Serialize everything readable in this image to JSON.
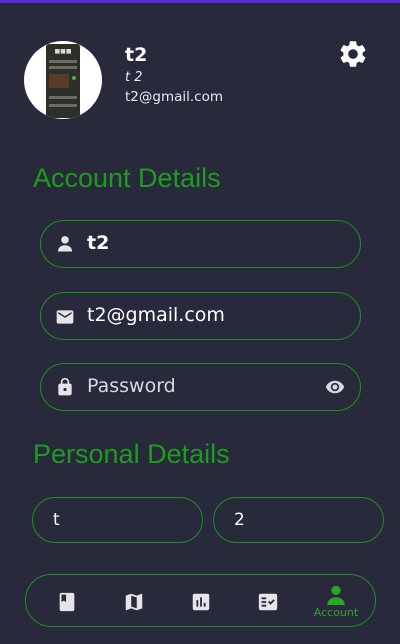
{
  "profile": {
    "name": "t2",
    "full_name": "t 2",
    "email": "t2@gmail.com"
  },
  "sections": {
    "account": "Account Details",
    "personal": "Personal Details"
  },
  "fields": {
    "username": "t2",
    "email": "t2@gmail.com",
    "password_placeholder": "Password",
    "first_name": "t",
    "last_name": "2"
  },
  "nav": {
    "items": [
      {
        "icon": "book-icon",
        "label": ""
      },
      {
        "icon": "map-icon",
        "label": ""
      },
      {
        "icon": "chart-icon",
        "label": ""
      },
      {
        "icon": "checklist-icon",
        "label": ""
      },
      {
        "icon": "person-icon",
        "label": "Account"
      }
    ]
  },
  "colors": {
    "background": "#282a3b",
    "accent": "#1f9b1f",
    "top_line": "#5b2bd9"
  }
}
